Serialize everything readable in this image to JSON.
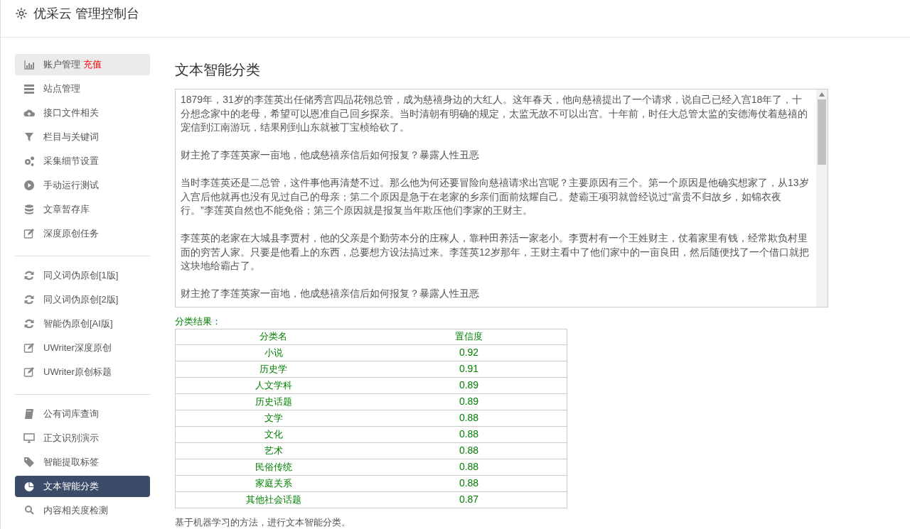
{
  "header": {
    "title": "优采云 管理控制台"
  },
  "sidebar": {
    "groups": [
      {
        "items": [
          {
            "label": "账户管理",
            "badge": "充值",
            "selected": false,
            "hover": true
          },
          {
            "label": "站点管理",
            "selected": false,
            "hover": false
          },
          {
            "label": "接口文件相关",
            "selected": false,
            "hover": false
          },
          {
            "label": "栏目与关键词",
            "selected": false,
            "hover": false
          },
          {
            "label": "采集细节设置",
            "selected": false,
            "hover": false
          },
          {
            "label": "手动运行测试",
            "selected": false,
            "hover": false
          },
          {
            "label": "文章暂存库",
            "selected": false,
            "hover": false
          },
          {
            "label": "深度原创任务",
            "selected": false,
            "hover": false
          }
        ]
      },
      {
        "items": [
          {
            "label": "同义词伪原创[1版]",
            "selected": false,
            "hover": false
          },
          {
            "label": "同义词伪原创[2版]",
            "selected": false,
            "hover": false
          },
          {
            "label": "智能伪原创[AI版]",
            "selected": false,
            "hover": false
          },
          {
            "label": "UWriter深度原创",
            "selected": false,
            "hover": false
          },
          {
            "label": "UWriter原创标题",
            "selected": false,
            "hover": false
          }
        ]
      },
      {
        "items": [
          {
            "label": "公有词库查询",
            "selected": false,
            "hover": false
          },
          {
            "label": "正文识别演示",
            "selected": false,
            "hover": false
          },
          {
            "label": "智能提取标签",
            "selected": false,
            "hover": false
          },
          {
            "label": "文本智能分类",
            "selected": true,
            "hover": false
          },
          {
            "label": "内容相关度检测",
            "selected": false,
            "hover": false
          }
        ]
      }
    ]
  },
  "main": {
    "title": "文本智能分类",
    "text_input": {
      "paragraphs": [
        "1879年，31岁的李莲英出任储秀宫四品花翎总管，成为慈禧身边的大红人。这年春天，他向慈禧提出了一个请求，说自己已经入宫18年了，十分想念家中的老母，希望可以恩准自己回乡探亲。当时清朝有明确的规定，太监无故不可以出宫。十年前，时任大总管太监的安德海仗着慈禧的宠信到江南游玩，结果刚到山东就被丁宝桢给砍了。",
        "财主抢了李莲英家一亩地，他成慈禧亲信后如何报复？暴露人性丑恶",
        "当时李莲英还是二总管，这件事他再清楚不过。那么他为何还要冒险向慈禧请求出宫呢？主要原因有三个。第一个原因是他确实想家了，从13岁入宫后他就再也没有见过自己的母亲；第二个原因是急于在老家的乡亲们面前炫耀自己。楚霸王项羽就曾经说过“富贵不归故乡，如锦衣夜行。”李莲英自然也不能免俗；第三个原因就是报复当年欺压他们李家的王财主。",
        "李莲英的老家在大城县李贾村，他的父亲是个勤劳本分的庄稼人，靠种田养活一家老小。李贾村有一个王姓财主，仗着家里有钱，经常欺负村里面的穷苦人家。只要是他看上的东西，总要想方设法搞过来。李莲英12岁那年，王财主看中了他们家中的一亩良田，然后随便找了一个借口就把这块地给霸占了。",
        "财主抢了李莲英家一亩地，他成慈禧亲信后如何报复？暴露人性丑恶"
      ]
    },
    "result_label": "分类结果：",
    "table": {
      "columns": [
        "分类名",
        "置信度"
      ],
      "rows": [
        [
          "小说",
          "0.92"
        ],
        [
          "历史学",
          "0.91"
        ],
        [
          "人文学科",
          "0.89"
        ],
        [
          "历史话题",
          "0.89"
        ],
        [
          "文学",
          "0.88"
        ],
        [
          "文化",
          "0.88"
        ],
        [
          "艺术",
          "0.88"
        ],
        [
          "民俗传统",
          "0.88"
        ],
        [
          "家庭关系",
          "0.88"
        ],
        [
          "其他社会话题",
          "0.87"
        ]
      ]
    },
    "footnote": "基于机器学习的方法，进行文本智能分类。"
  }
}
